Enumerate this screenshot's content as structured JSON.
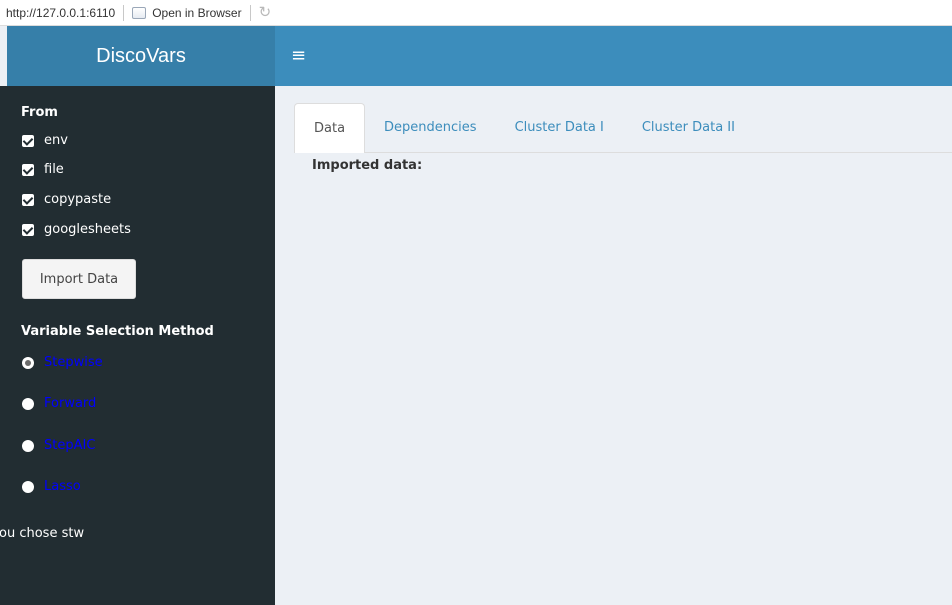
{
  "browser": {
    "url": "http://127.0.0.1:6110",
    "open_label": "Open in Browser"
  },
  "header": {
    "app_title": "DiscoVars"
  },
  "sidebar": {
    "from_label": "From",
    "sources": [
      {
        "label": "env",
        "checked": true
      },
      {
        "label": "file",
        "checked": true
      },
      {
        "label": "copypaste",
        "checked": true
      },
      {
        "label": "googlesheets",
        "checked": true
      }
    ],
    "import_button": "Import Data",
    "method_label": "Variable Selection Method",
    "methods": [
      {
        "label": "Stepwise",
        "selected": true
      },
      {
        "label": "Forward",
        "selected": false
      },
      {
        "label": "StepAIC",
        "selected": false
      },
      {
        "label": "Lasso",
        "selected": false
      }
    ],
    "chose_text": "ou chose stw"
  },
  "main": {
    "tabs": [
      {
        "label": "Data",
        "active": true
      },
      {
        "label": "Dependencies",
        "active": false
      },
      {
        "label": "Cluster Data I",
        "active": false
      },
      {
        "label": "Cluster Data II",
        "active": false
      }
    ],
    "imported_label": "Imported data:"
  },
  "colors": {
    "header_logo": "#367fa9",
    "header_nav": "#3c8dbc",
    "sidebar_bg": "#222d32",
    "body_bg": "#ecf0f5",
    "radio_label": "#0000ff",
    "tab_link": "#3c8dbc"
  },
  "icons": {
    "menu": "hamburger-icon",
    "open_in_browser": "document-icon",
    "refresh": "refresh-icon"
  }
}
